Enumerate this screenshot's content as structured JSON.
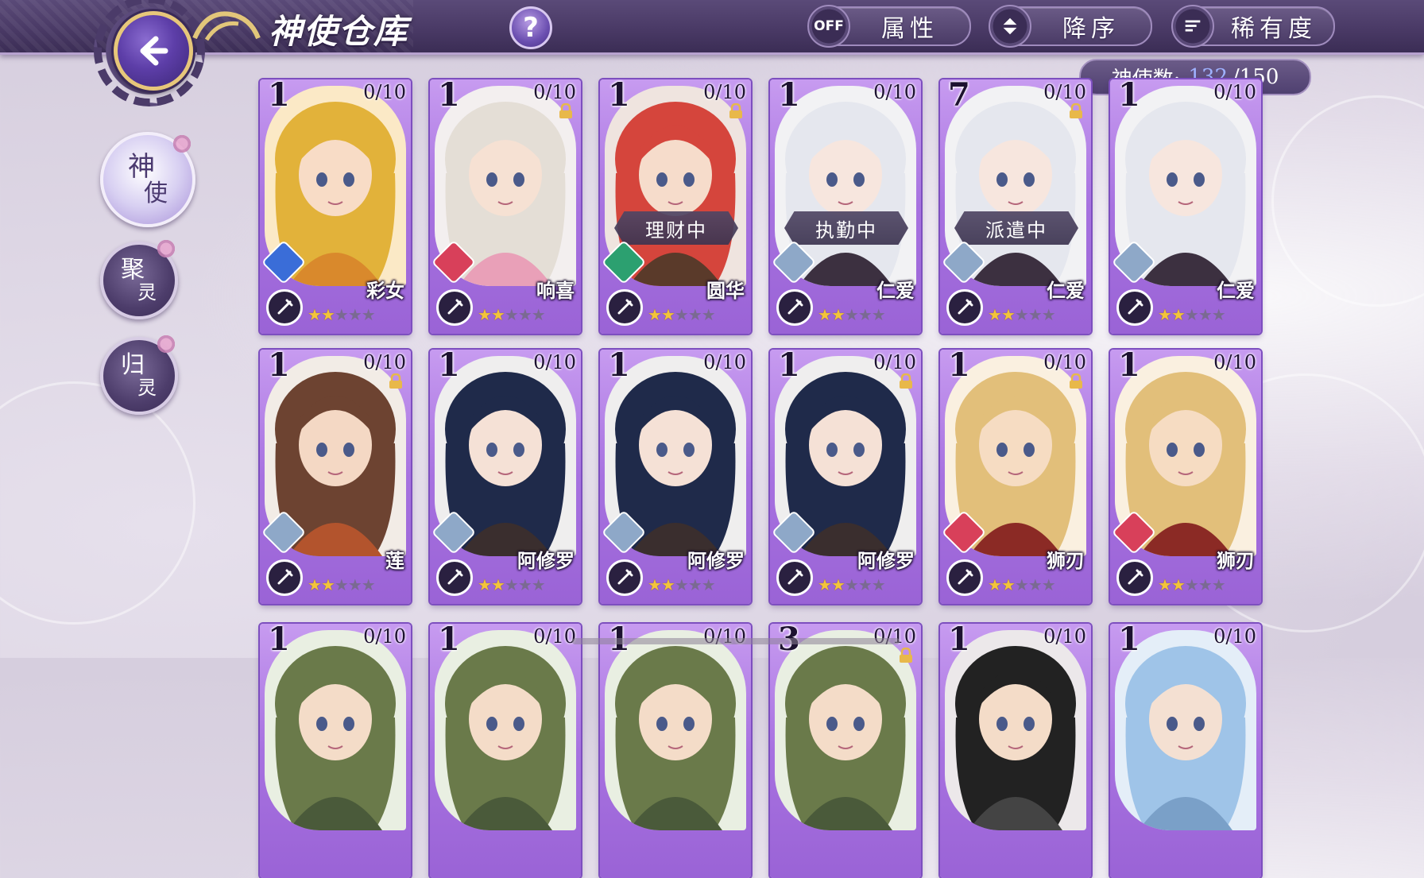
{
  "header": {
    "title": "神使仓库",
    "help_label": "?",
    "filters": [
      {
        "icon": "OFF",
        "label": "属性"
      },
      {
        "icon": "sort-icon",
        "label": "降序"
      },
      {
        "icon": "list-icon",
        "label": "稀有度"
      }
    ],
    "count": {
      "label": "神使数:",
      "current": "132",
      "max": "/150"
    }
  },
  "tabs": [
    {
      "t1": "神",
      "t2": "使",
      "active": true
    },
    {
      "t1": "聚",
      "t2": "灵",
      "active": false
    },
    {
      "t1": "归",
      "t2": "灵",
      "active": false
    }
  ],
  "cards": [
    {
      "level": "1",
      "progress": "0/10",
      "name": "彩女",
      "locked": false,
      "status": "",
      "element": "#3a6dd8",
      "stars": 2,
      "art": "gold"
    },
    {
      "level": "1",
      "progress": "0/10",
      "name": "响喜",
      "locked": true,
      "status": "",
      "element": "#d8405a",
      "stars": 2,
      "art": "white"
    },
    {
      "level": "1",
      "progress": "0/10",
      "name": "圆华",
      "locked": true,
      "status": "理财中",
      "element": "#2ca070",
      "stars": 2,
      "art": "red"
    },
    {
      "level": "1",
      "progress": "0/10",
      "name": "仁爱",
      "locked": false,
      "status": "执勤中",
      "element": "#8ea8c8",
      "stars": 2,
      "art": "silver"
    },
    {
      "level": "7",
      "progress": "0/10",
      "name": "仁爱",
      "locked": true,
      "status": "派遣中",
      "element": "#8ea8c8",
      "stars": 2,
      "art": "silver"
    },
    {
      "level": "1",
      "progress": "0/10",
      "name": "仁爱",
      "locked": false,
      "status": "",
      "element": "#8ea8c8",
      "stars": 2,
      "art": "silver"
    },
    {
      "level": "1",
      "progress": "0/10",
      "name": "莲",
      "locked": true,
      "status": "",
      "element": "#8ea8c8",
      "stars": 2,
      "art": "brown"
    },
    {
      "level": "1",
      "progress": "0/10",
      "name": "阿修罗",
      "locked": false,
      "status": "",
      "element": "#8ea8c8",
      "stars": 2,
      "art": "navy"
    },
    {
      "level": "1",
      "progress": "0/10",
      "name": "阿修罗",
      "locked": false,
      "status": "",
      "element": "#8ea8c8",
      "stars": 2,
      "art": "navy"
    },
    {
      "level": "1",
      "progress": "0/10",
      "name": "阿修罗",
      "locked": true,
      "status": "",
      "element": "#8ea8c8",
      "stars": 2,
      "art": "navy"
    },
    {
      "level": "1",
      "progress": "0/10",
      "name": "狮刃",
      "locked": true,
      "status": "",
      "element": "#d8405a",
      "stars": 2,
      "art": "lion"
    },
    {
      "level": "1",
      "progress": "0/10",
      "name": "狮刃",
      "locked": false,
      "status": "",
      "element": "#d8405a",
      "stars": 2,
      "art": "lion"
    },
    {
      "level": "1",
      "progress": "0/10",
      "name": "",
      "locked": false,
      "status": "",
      "element": "",
      "stars": 0,
      "art": "olive"
    },
    {
      "level": "1",
      "progress": "0/10",
      "name": "",
      "locked": false,
      "status": "",
      "element": "",
      "stars": 0,
      "art": "olive"
    },
    {
      "level": "1",
      "progress": "0/10",
      "name": "",
      "locked": false,
      "status": "",
      "element": "",
      "stars": 0,
      "art": "olive"
    },
    {
      "level": "3",
      "progress": "0/10",
      "name": "",
      "locked": true,
      "status": "",
      "element": "",
      "stars": 0,
      "art": "olive"
    },
    {
      "level": "1",
      "progress": "0/10",
      "name": "",
      "locked": false,
      "status": "",
      "element": "",
      "stars": 0,
      "art": "dark"
    },
    {
      "level": "1",
      "progress": "0/10",
      "name": "",
      "locked": false,
      "status": "",
      "element": "",
      "stars": 0,
      "art": "sky"
    }
  ],
  "colors": {
    "accent": "#a772e0",
    "bar": "#4a3a66",
    "count_value": "#9fb2ff"
  }
}
